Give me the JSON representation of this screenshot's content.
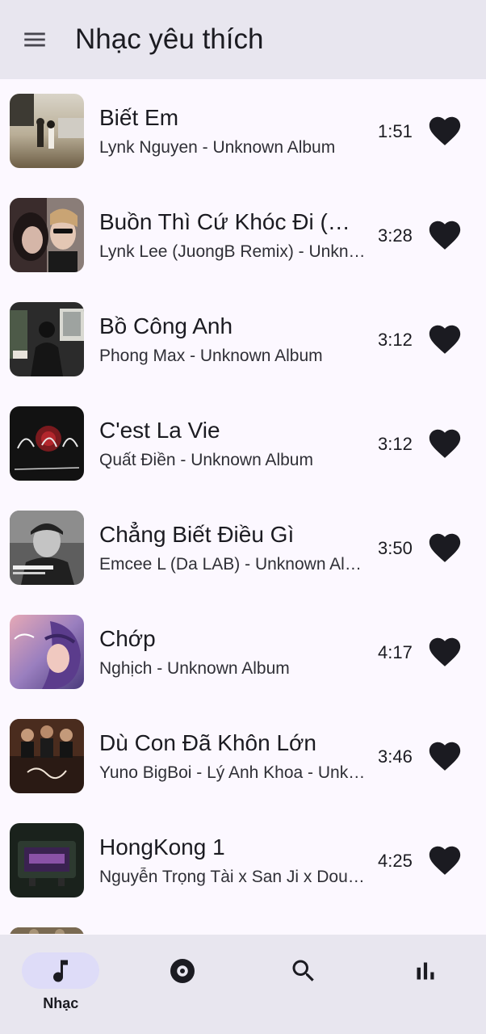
{
  "app_bar": {
    "title": "Nhạc yêu thích",
    "menu_icon": "menu-icon"
  },
  "songs": [
    {
      "title": "Biết Em",
      "subtitle": "Lynk Nguyen - Unknown Album",
      "duration": "1:51"
    },
    {
      "title": "Buồn Thì Cứ Khóc Đi (JuongB Remix)",
      "subtitle": "Lynk Lee  (JuongB Remix) - Unknown Album",
      "duration": "3:28"
    },
    {
      "title": "Bồ Công Anh",
      "subtitle": "Phong Max - Unknown Album",
      "duration": "3:12"
    },
    {
      "title": "C'est La Vie",
      "subtitle": "Quất Điền - Unknown Album",
      "duration": "3:12"
    },
    {
      "title": "Chẳng Biết Điều Gì",
      "subtitle": "Emcee L (Da LAB) - Unknown Album",
      "duration": "3:50"
    },
    {
      "title": "Chớp",
      "subtitle": "Nghịch - Unknown Album",
      "duration": "4:17"
    },
    {
      "title": "Dù Con Đã Khôn Lớn",
      "subtitle": "Yuno BigBoi - Lý Anh Khoa - Unknown Album",
      "duration": "3:46"
    },
    {
      "title": "HongKong 1",
      "subtitle": "Nguyễn Trọng Tài x San Ji x Double X - Unknown Album",
      "duration": "4:25"
    }
  ],
  "bottom_nav": {
    "items": [
      {
        "label": "Nhạc",
        "icon": "music-note-icon",
        "active": true
      },
      {
        "label": "",
        "icon": "album-disc-icon",
        "active": false
      },
      {
        "label": "",
        "icon": "search-icon",
        "active": false
      },
      {
        "label": "",
        "icon": "bar-chart-icon",
        "active": false
      }
    ]
  },
  "colors": {
    "background": "#fcf8ff",
    "app_bar": "#e8e6ef",
    "active_pill": "#dedcf8",
    "text": "#1b1b21"
  }
}
